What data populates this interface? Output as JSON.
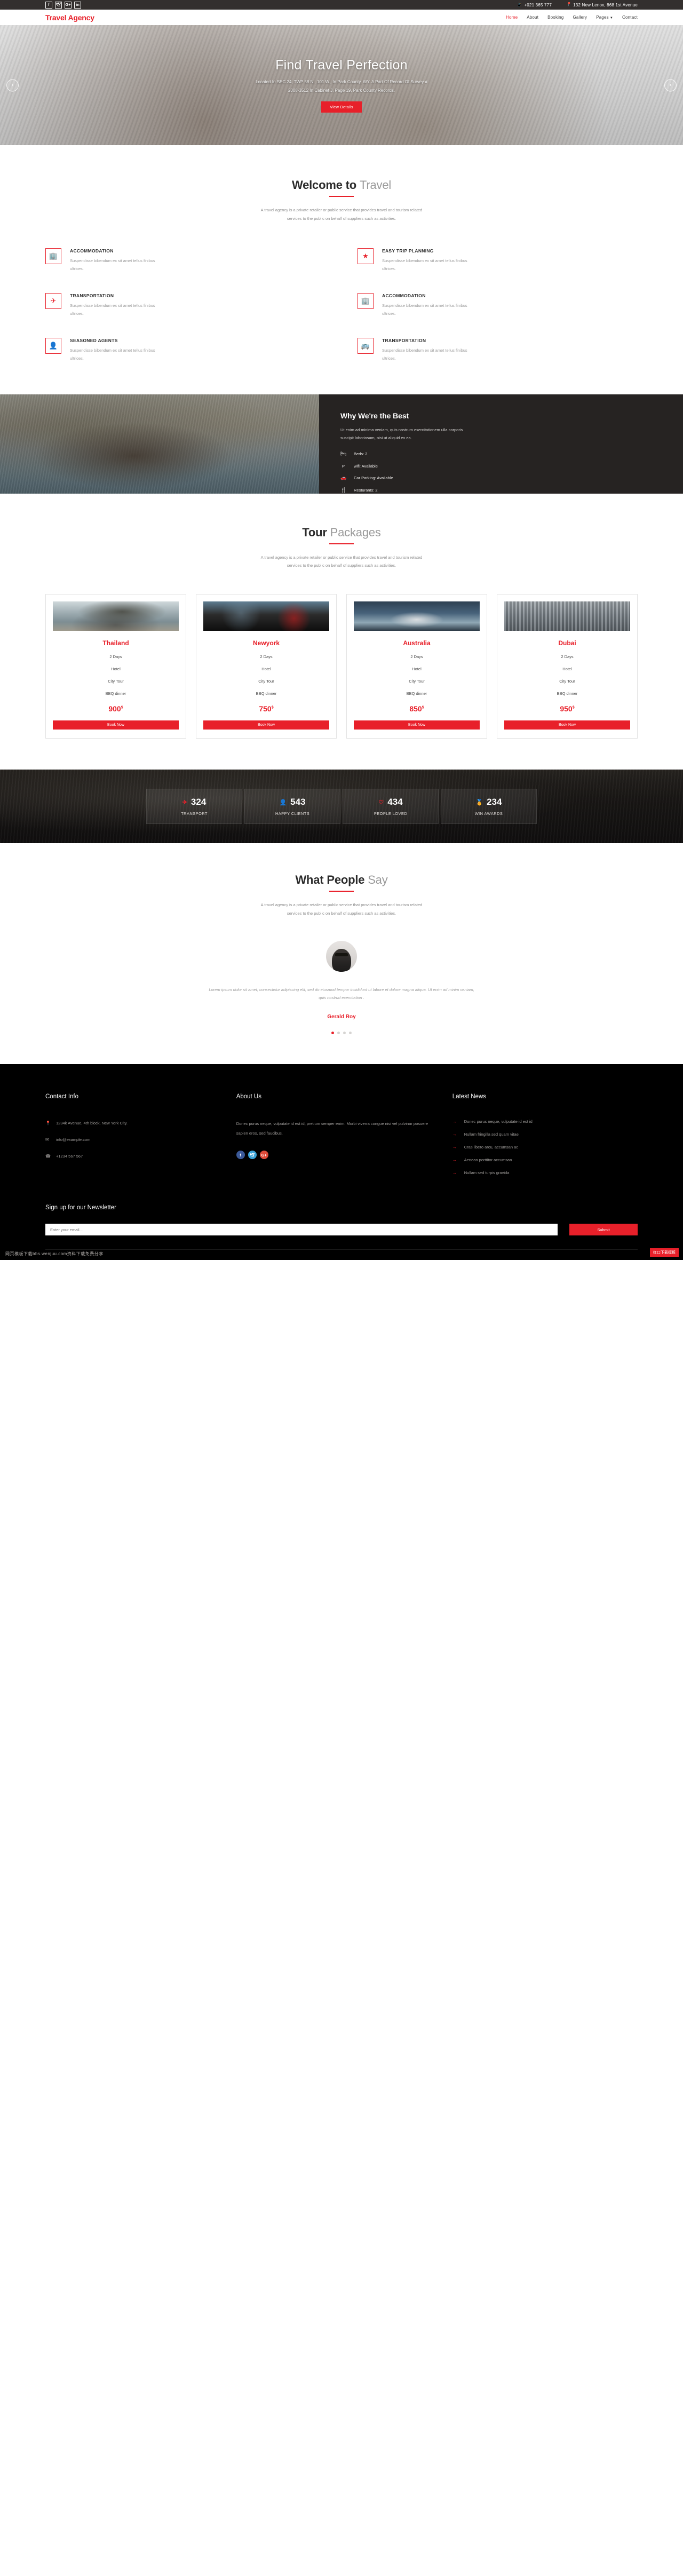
{
  "topbar": {
    "social": [
      {
        "name": "facebook-icon",
        "glyph": "f"
      },
      {
        "name": "twitter-icon",
        "glyph": "🕊"
      },
      {
        "name": "google-plus-icon",
        "glyph": "G+"
      },
      {
        "name": "linkedin-icon",
        "glyph": "in"
      }
    ],
    "phone_icon": "📱",
    "phone": "+021 365 777",
    "location_icon": "📍",
    "address": "132 New Lenox, 868 1st Avenue"
  },
  "nav": {
    "logo": "Travel Agency",
    "items": [
      {
        "label": "Home",
        "active": true
      },
      {
        "label": "About",
        "active": false
      },
      {
        "label": "Booking",
        "active": false
      },
      {
        "label": "Gallery",
        "active": false
      },
      {
        "label": "Pages",
        "active": false,
        "caret": "▼"
      },
      {
        "label": "Contact",
        "active": false
      }
    ]
  },
  "hero": {
    "title": "Find Travel Perfection",
    "desc_line1": "Located In SEC 24, TWP 58 N., 101 W., In Park County, WY. A Part Of Record Of Survey #",
    "desc_line2": "2008-3512 In Cabinet J, Page 19, Park County Records.",
    "cta": "View Details",
    "prev": "‹",
    "next": "›"
  },
  "welcome": {
    "title_bold": "Welcome to",
    "title_light": "Travel",
    "sub_line1": "A travel agency is a private retailer or public service that provides travel and tourism related",
    "sub_line2": "services to the public on behalf of suppliers such as activities.",
    "features": [
      {
        "icon": "hotel-icon",
        "glyph": "🏢",
        "title": "ACCOMMODATION",
        "desc": "Suspendisse bibendum ex sit amet tellus finibus ultrices."
      },
      {
        "icon": "star-icon",
        "glyph": "★",
        "title": "EASY TRIP PLANNING",
        "desc": "Suspendisse bibendum ex sit amet tellus finibus ultrices."
      },
      {
        "icon": "plane-icon",
        "glyph": "✈",
        "title": "TRANSPORTATION",
        "desc": "Suspendisse bibendum ex sit amet tellus finibus ultrices."
      },
      {
        "icon": "hotel-icon",
        "glyph": "🏢",
        "title": "ACCOMMODATION",
        "desc": "Suspendisse bibendum ex sit amet tellus finibus ultrices."
      },
      {
        "icon": "user-icon",
        "glyph": "👤",
        "title": "SEASONED AGENTS",
        "desc": "Suspendisse bibendum ex sit amet tellus finibus ultrices."
      },
      {
        "icon": "bus-icon",
        "glyph": "🚌",
        "title": "TRANSPORTATION",
        "desc": "Suspendisse bibendum ex sit amet tellus finibus ultrices."
      }
    ]
  },
  "why": {
    "title": "Why We're the Best",
    "desc": "Ut enim ad minima veniam, quis nostrum exercitationem ulla corporis suscipit laboriosam, nisi ut aliquid ex ea.",
    "items": [
      {
        "icon": "bed-icon",
        "glyph": "🛏",
        "label": "Beds: 2"
      },
      {
        "icon": "wifi-icon",
        "glyph": "ᴘ",
        "label": "wifi: Available"
      },
      {
        "icon": "car-icon",
        "glyph": "🚗",
        "label": "Car Parking: Available"
      },
      {
        "icon": "restaurant-icon",
        "glyph": "🍴",
        "label": "Resturants: 2"
      }
    ]
  },
  "packages": {
    "title_bold": "Tour",
    "title_light": "Packages",
    "sub_line1": "A travel agency is a private retailer or public service that provides travel and tourism related",
    "sub_line2": "services to the public on behalf of suppliers such as activities.",
    "cards": [
      {
        "name": "Thailand",
        "days": "2 Days",
        "stay": "Hotel",
        "tour": "City Tour",
        "meal": "BBQ dinner",
        "price": "900",
        "currency": "$",
        "book": "Book Now",
        "img": "thailand"
      },
      {
        "name": "Newyork",
        "days": "2 Days",
        "stay": "Hotel",
        "tour": "City Tour",
        "meal": "BBQ dinner",
        "price": "750",
        "currency": "$",
        "book": "Book Now",
        "img": "newyork"
      },
      {
        "name": "Australia",
        "days": "2 Days",
        "stay": "Hotel",
        "tour": "City Tour",
        "meal": "BBQ dinner",
        "price": "850",
        "currency": "$",
        "book": "Book Now",
        "img": "australia"
      },
      {
        "name": "Dubai",
        "days": "2 Days",
        "stay": "Hotel",
        "tour": "City Tour",
        "meal": "BBQ dinner",
        "price": "950",
        "currency": "$",
        "book": "Book Now",
        "img": "dubai"
      }
    ]
  },
  "counters": [
    {
      "icon": "transport-icon",
      "glyph": "✈",
      "value": "324",
      "label": "TRANSPORT"
    },
    {
      "icon": "clients-icon",
      "glyph": "👤",
      "value": "543",
      "label": "HAPPY CLIENTS"
    },
    {
      "icon": "heart-icon",
      "glyph": "♡",
      "value": "434",
      "label": "PEOPLE LOVED"
    },
    {
      "icon": "award-icon",
      "glyph": "🏅",
      "value": "234",
      "label": "WIN AWARDS"
    }
  ],
  "testimonials": {
    "title_bold": "What People",
    "title_light": "Say",
    "sub_line1": "A travel agency is a private retailer or public service that provides travel and tourism related",
    "sub_line2": "services to the public on behalf of suppliers such as activities.",
    "quote": "Lorem ipsum dolor sit amet, consectetur adipiscing elit, sed do eiusmod tempor incididunt ut labore et dolore magna aliqua. Ut enim ad minim veniam, quis nostrud exercitation .",
    "author": "Gerald Roy",
    "dots": [
      true,
      false,
      false,
      false
    ]
  },
  "footer": {
    "contact": {
      "title": "Contact Info",
      "lines": [
        {
          "icon": "location-icon",
          "glyph": "📍",
          "text": "1234k Avenue, 4th block, New York City."
        },
        {
          "icon": "mail-icon",
          "glyph": "✉",
          "text": "info@example.com"
        },
        {
          "icon": "phone-icon",
          "glyph": "☎",
          "text": "+1234 567 567"
        }
      ]
    },
    "about": {
      "title": "About Us",
      "text": "Donec purus neque, vulputate id est id, pretium semper enim. Morbi viverra congue nisi vel pulvinar posuere sapien eros, sed faucibus.",
      "social": [
        {
          "name": "facebook-icon",
          "glyph": "f",
          "cls": "fs-fb"
        },
        {
          "name": "twitter-icon",
          "glyph": "🕊",
          "cls": "fs-tw"
        },
        {
          "name": "google-plus-icon",
          "glyph": "G+",
          "cls": "fs-gp"
        }
      ]
    },
    "news": {
      "title": "Latest News",
      "items": [
        "Donec purus neque, vulputate id est id",
        "Nullam fringilla sed quam vitae",
        "Cras libero arcu, accumsan ac",
        "Aenean porttitor accumsan",
        "Nullam sed turpis gravida"
      ],
      "arrow": "→"
    },
    "newsletter": {
      "title": "Sign up for our Newsletter",
      "placeholder": "Enter your email...",
      "submit": "Submit"
    },
    "watermark": "网页模板下载bbs.wenjuu.com资料下载免费分享",
    "download_badge": "红口下载模板"
  },
  "colors": {
    "accent": "#e8202a",
    "dark": "#262322",
    "topbar": "#332f2e"
  }
}
